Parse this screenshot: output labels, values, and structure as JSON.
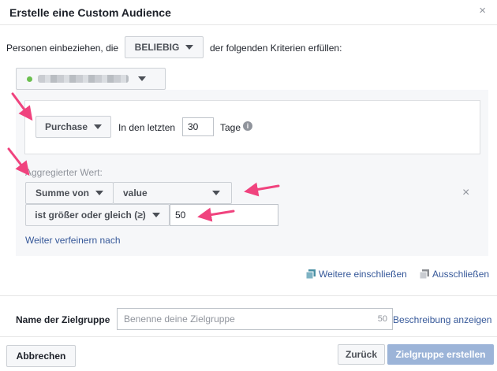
{
  "dialog": {
    "title": "Erstelle eine Custom Audience",
    "close_glyph": "×"
  },
  "criteria": {
    "prefix": "Personen einbeziehen, die",
    "mode_button": "BELIEBIG",
    "suffix": "der folgenden Kriterien erfüllen:"
  },
  "pixel_selector": {
    "status_color": "#6bbf4f"
  },
  "event_rule": {
    "event_button": "Purchase",
    "in_last_label": "In den letzten",
    "days_value": "30",
    "days_label": "Tage"
  },
  "aggregation": {
    "label": "Aggregierter Wert:",
    "sum_button": "Summe von",
    "field_select": "value",
    "operator_button": "ist größer oder gleich (≥)",
    "threshold_value": "50",
    "remove_glyph": "×",
    "refine_link": "Weiter verfeinern nach"
  },
  "actions": {
    "include_more": "Weitere einschließen",
    "exclude": "Ausschließen"
  },
  "audience_name": {
    "label": "Name der Zielgruppe",
    "placeholder": "Benenne deine Zielgruppe",
    "char_count": "50",
    "description_link": "Beschreibung anzeigen"
  },
  "footer": {
    "cancel": "Abbrechen",
    "back": "Zurück",
    "create": "Zielgruppe erstellen"
  },
  "colors": {
    "accent": "#365899",
    "primary_disabled": "#9cb4d8",
    "annotation_arrow": "#f0437e"
  }
}
